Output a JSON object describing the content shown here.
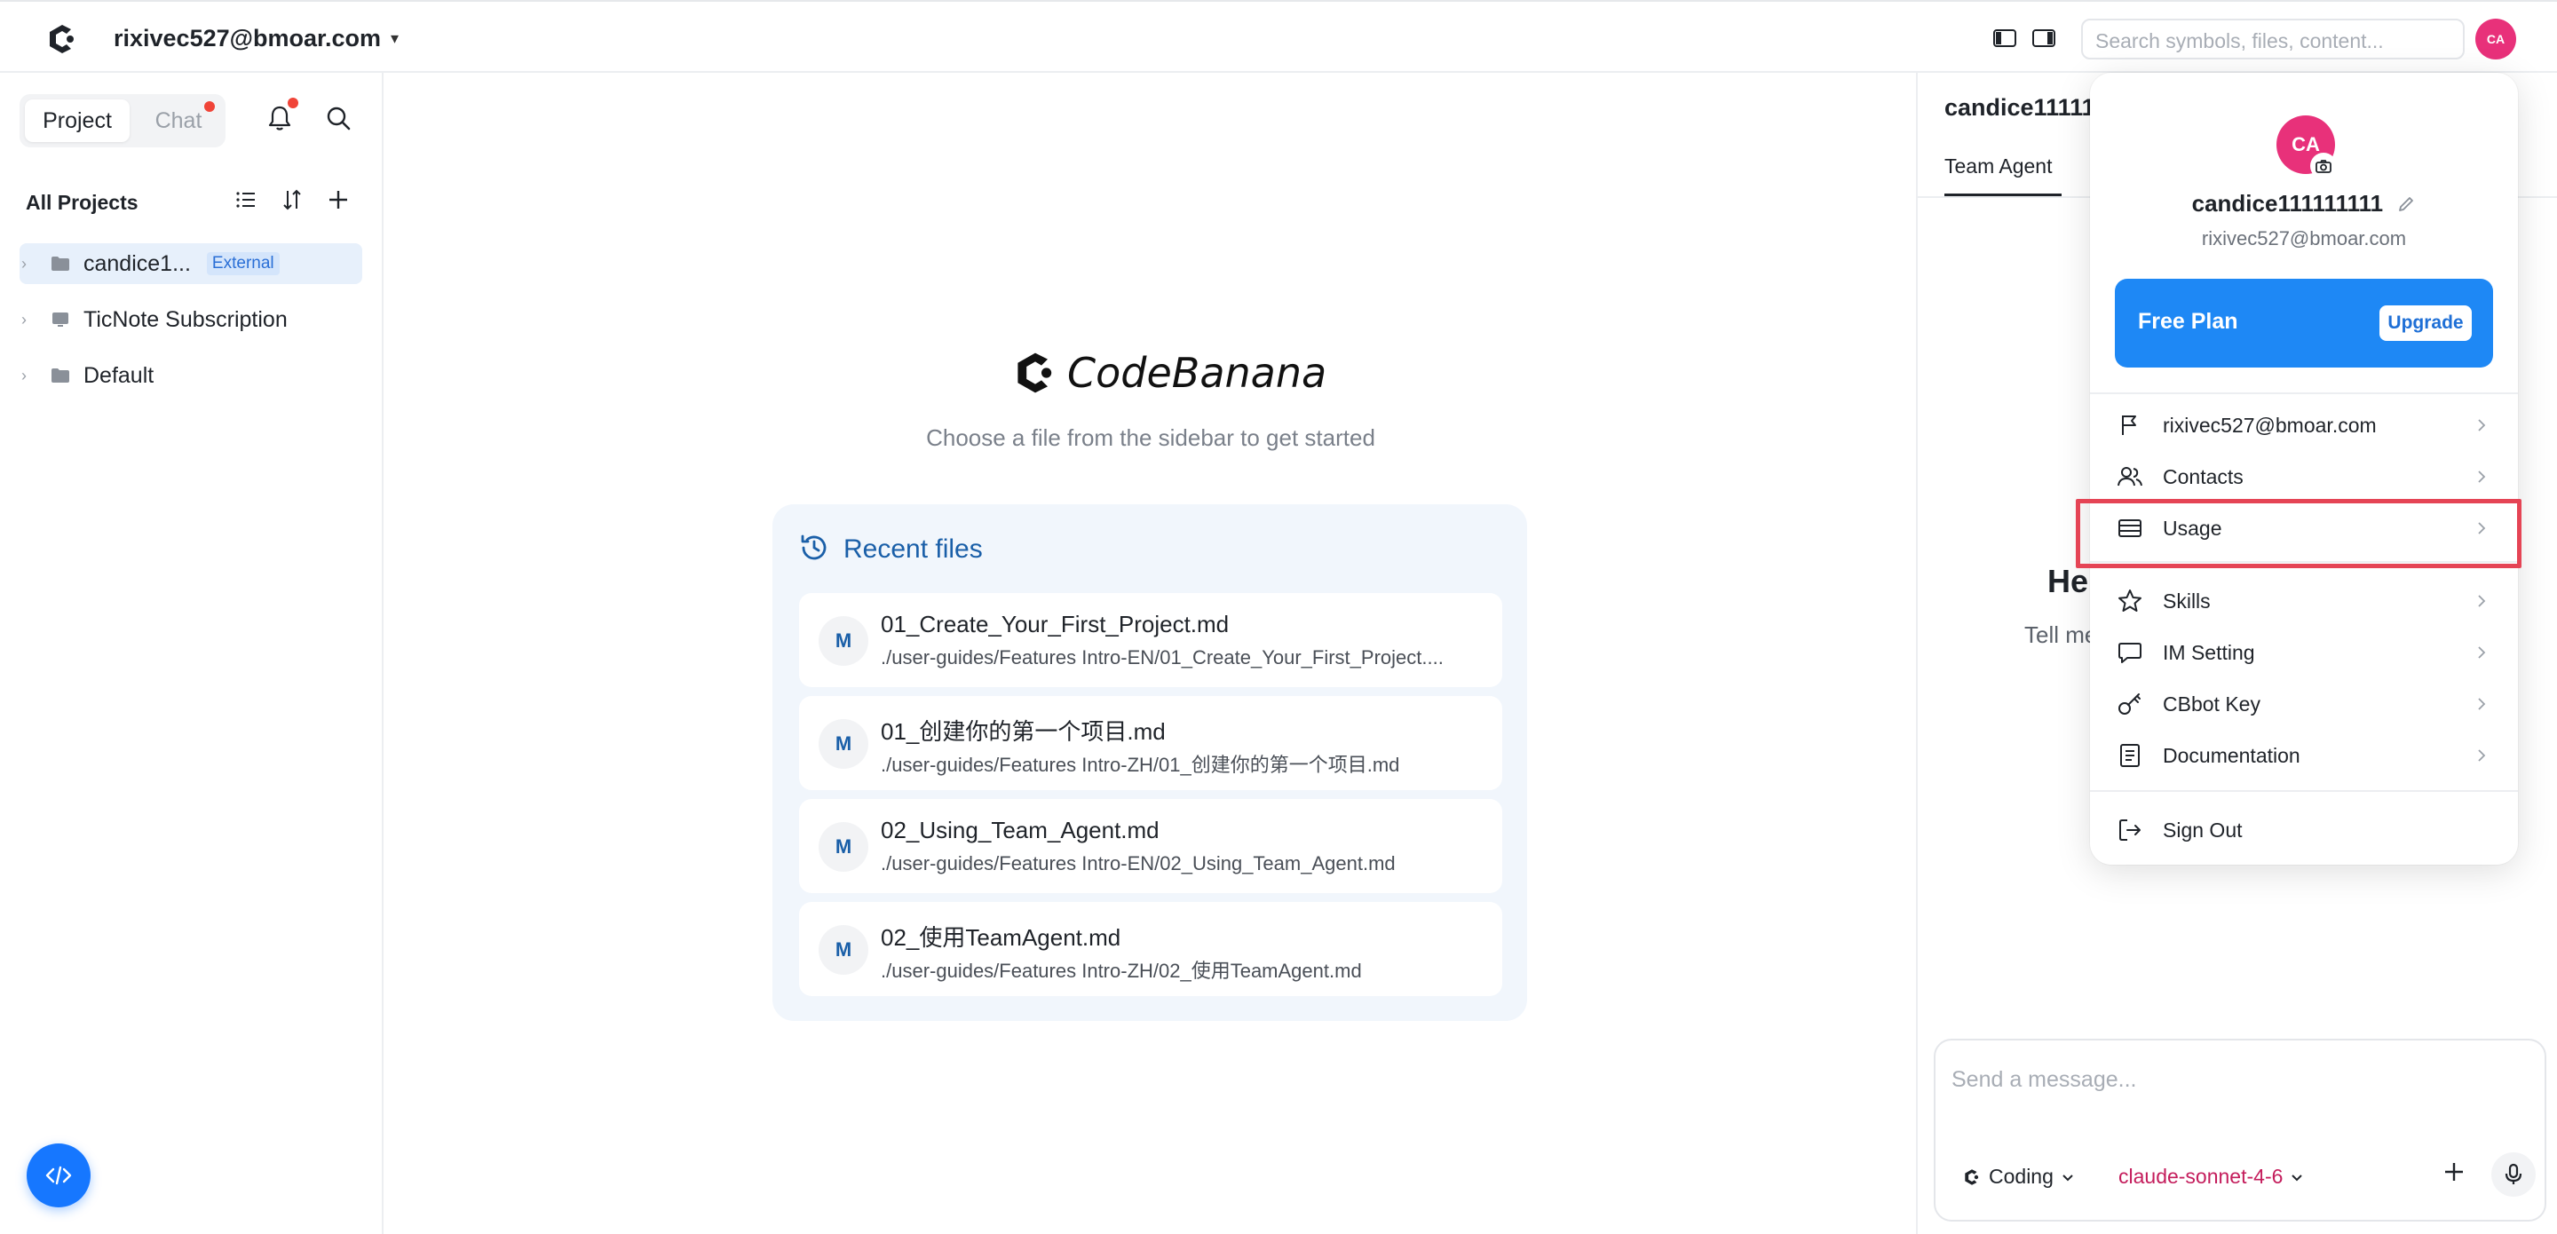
{
  "topbar": {
    "account": "rixivec527@bmoar.com",
    "caret": "▾",
    "search_placeholder": "Search symbols, files, content...",
    "avatar_initials": "CA"
  },
  "sidebar": {
    "tabs": {
      "project": "Project",
      "chat": "Chat"
    },
    "section_title": "All Projects",
    "items": [
      {
        "label": "candice1...",
        "badge": "External",
        "icon": "folder-icon",
        "selected": true
      },
      {
        "label": "TicNote Subscription",
        "icon": "monitor-icon",
        "selected": false
      },
      {
        "label": "Default",
        "icon": "folder-icon",
        "selected": false
      }
    ]
  },
  "main": {
    "brand": "CodeBanana",
    "subtitle": "Choose a file from the sidebar to get started",
    "recent_title": "Recent files",
    "recent_files": [
      {
        "badge": "M",
        "name": "01_Create_Your_First_Project.md",
        "path": "./user-guides/Features Intro-EN/01_Create_Your_First_Project...."
      },
      {
        "badge": "M",
        "name": "01_创建你的第一个项目.md",
        "path": "./user-guides/Features Intro-ZH/01_创建你的第一个项目.md"
      },
      {
        "badge": "M",
        "name": "02_Using_Team_Agent.md",
        "path": "./user-guides/Features Intro-EN/02_Using_Team_Agent.md"
      },
      {
        "badge": "M",
        "name": "02_使用TeamAgent.md",
        "path": "./user-guides/Features Intro-ZH/02_使用TeamAgent.md"
      }
    ]
  },
  "right_panel": {
    "title": "candice11111",
    "tab": "Team Agent",
    "greeting_partial": "He",
    "tell_partial": "Tell me",
    "composer_placeholder": "Send a message...",
    "mode": "Coding",
    "model": "claude-sonnet-4-6"
  },
  "menu": {
    "avatar_initials": "CA",
    "username": "candice111111111",
    "email": "rixivec527@bmoar.com",
    "plan": "Free Plan",
    "upgrade": "Upgrade",
    "items": [
      {
        "label": "rixivec527@bmoar.com",
        "icon": "flag-icon"
      },
      {
        "label": "Contacts",
        "icon": "users-icon"
      },
      {
        "label": "Usage",
        "icon": "usage-icon"
      },
      {
        "label": "Skills",
        "icon": "star-icon"
      },
      {
        "label": "IM Setting",
        "icon": "chat-bubble-icon"
      },
      {
        "label": "CBbot Key",
        "icon": "key-icon"
      },
      {
        "label": "Documentation",
        "icon": "document-icon"
      },
      {
        "label": "Sign Out",
        "icon": "sign-out-icon"
      }
    ]
  },
  "colors": {
    "accent": "#1e88f5",
    "avatar": "#e8317a",
    "highlight": "#e54455",
    "notification_dot": "#f04438"
  }
}
